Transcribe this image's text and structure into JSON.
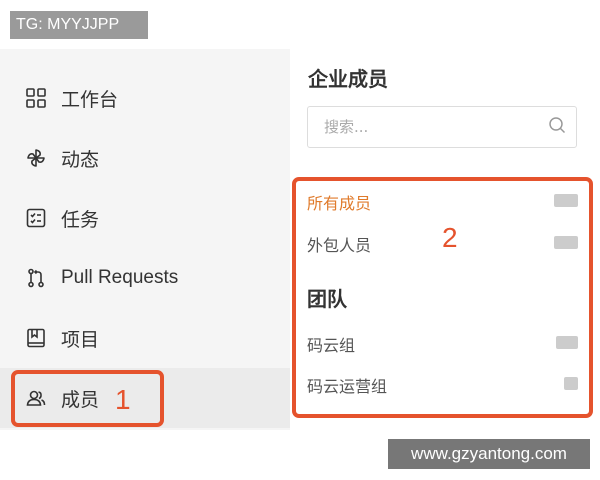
{
  "watermark_top": "TG: MYYJJPP",
  "watermark_bottom": "www.gzyantong.com",
  "sidebar": {
    "items": [
      {
        "label": "工作台",
        "icon": "dashboard-grid-icon"
      },
      {
        "label": "动态",
        "icon": "pinwheel-icon"
      },
      {
        "label": "任务",
        "icon": "task-checklist-icon"
      },
      {
        "label": "Pull Requests",
        "icon": "pull-request-icon"
      },
      {
        "label": "项目",
        "icon": "book-icon"
      },
      {
        "label": "成员",
        "icon": "members-icon",
        "active": true
      }
    ]
  },
  "panel": {
    "title": "企业成员",
    "search_placeholder": "搜索...",
    "members": [
      {
        "label": "所有成员",
        "active": true
      },
      {
        "label": "外包人员",
        "active": false
      }
    ],
    "team_heading": "团队",
    "teams": [
      {
        "label": "码云组"
      },
      {
        "label": "码云运营组"
      }
    ]
  },
  "annotations": {
    "one": "1",
    "two": "2"
  },
  "colors": {
    "accent": "#e07b2c",
    "annotation": "#e5532d",
    "sidebar_bg": "#f5f5f5"
  }
}
